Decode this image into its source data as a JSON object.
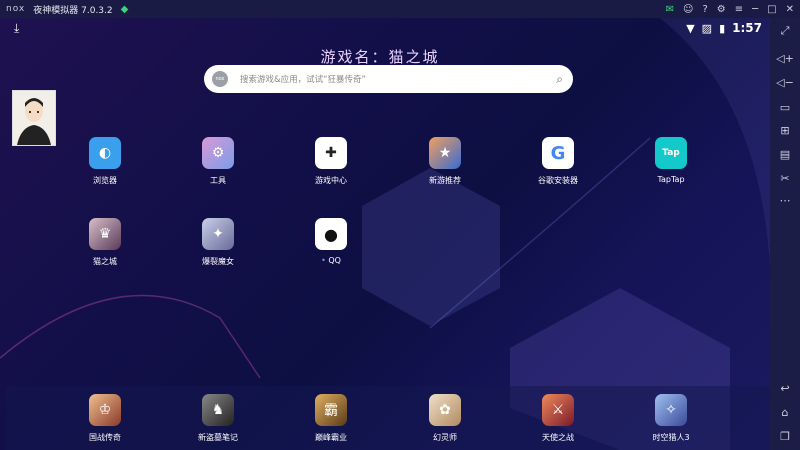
{
  "titlebar": {
    "logo": "nox",
    "title": "夜神模拟器 7.0.3.2"
  },
  "status": {
    "time": "1:57"
  },
  "game_name": "游戏名：猫之城",
  "search": {
    "placeholder": "搜索游戏&应用，试试“狂暴传奇”",
    "badge": "nox"
  },
  "apps": [
    {
      "label": "浏览器",
      "icon": "browser-icon",
      "color": "#3aa0ee",
      "glyph": "◐"
    },
    {
      "label": "工具",
      "icon": "tools-icon",
      "color": "#c98ad6",
      "glyph": "⚙"
    },
    {
      "label": "游戏中心",
      "icon": "game-center-icon",
      "color": "#ffffff",
      "glyph": "🎮"
    },
    {
      "label": "新游推荐",
      "icon": "new-game-icon",
      "color": "#e8884a",
      "glyph": "★"
    },
    {
      "label": "谷歌安装器",
      "icon": "google-installer-icon",
      "color": "#ffffff",
      "glyph": "G"
    },
    {
      "label": "TapTap",
      "icon": "taptap-icon",
      "color": "#14c9c9",
      "glyph": "Tap"
    },
    {
      "label": "猫之城",
      "icon": "cat-city-icon",
      "color": "#7a5a8a",
      "glyph": "♛"
    },
    {
      "label": "爆裂魔女",
      "icon": "witch-icon",
      "color": "#9aa3c8",
      "glyph": "✦"
    },
    {
      "label": "QQ",
      "icon": "qq-icon",
      "color": "#ffffff",
      "glyph": "🐧"
    }
  ],
  "dock": [
    {
      "label": "国战传奇",
      "icon": "guozhan-icon",
      "color": "#d4864a"
    },
    {
      "label": "新盗墓笔记",
      "icon": "daomu-icon",
      "color": "#555566"
    },
    {
      "label": "巅峰霸业",
      "icon": "dianfeng-icon",
      "color": "#b8863a"
    },
    {
      "label": "幻灵师",
      "icon": "huanling-icon",
      "color": "#e0c9a8"
    },
    {
      "label": "天使之战",
      "icon": "angel-war-icon",
      "color": "#c94a3a"
    },
    {
      "label": "时空猎人3",
      "icon": "hunter-icon",
      "color": "#6a8ad8"
    }
  ]
}
